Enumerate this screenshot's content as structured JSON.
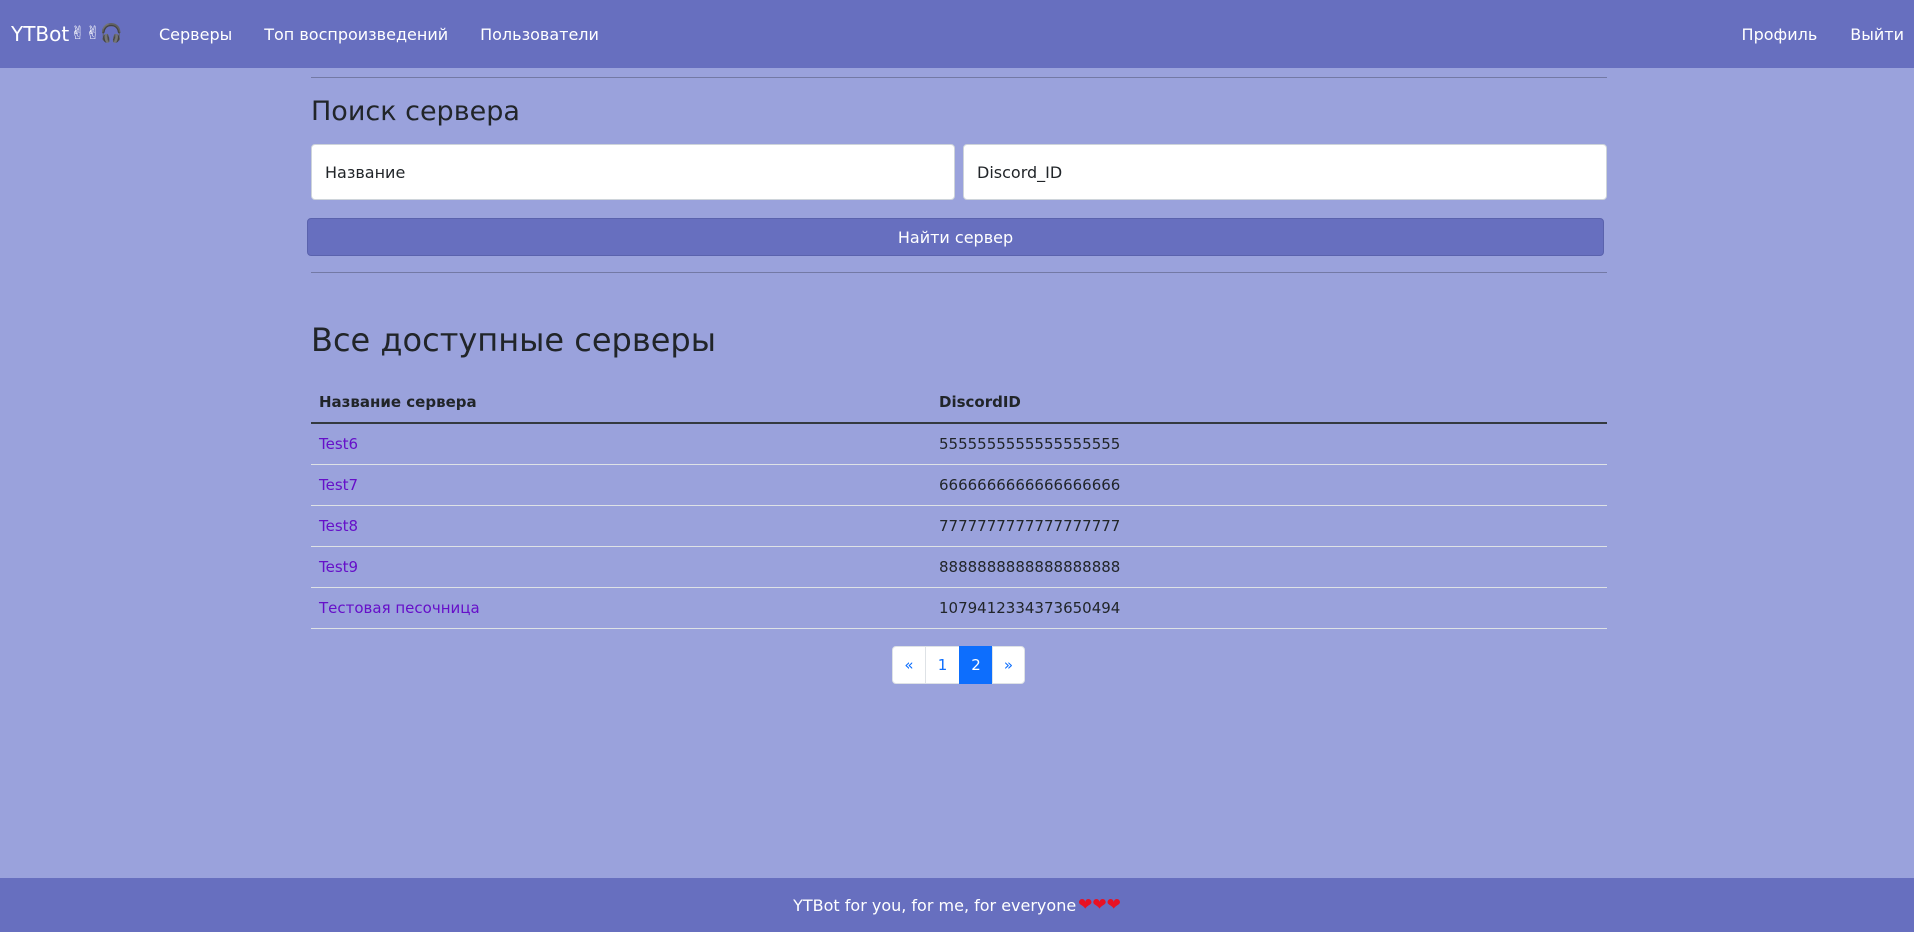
{
  "navbar": {
    "brand": "YTBot",
    "brand_emoji": "✌✌🎧",
    "links": [
      "Серверы",
      "Топ воспроизведений",
      "Пользователи"
    ],
    "profile": "Профиль",
    "logout": "Выйти"
  },
  "search": {
    "title": "Поиск сервера",
    "name_placeholder": "Название",
    "id_placeholder": "Discord_ID",
    "button": "Найти сервер"
  },
  "servers": {
    "title": "Все доступные серверы",
    "columns": [
      "Название сервера",
      "DiscordID"
    ],
    "rows": [
      {
        "name": "Test6",
        "discord_id": "5555555555555555555"
      },
      {
        "name": "Test7",
        "discord_id": "6666666666666666666"
      },
      {
        "name": "Test8",
        "discord_id": "7777777777777777777"
      },
      {
        "name": "Test9",
        "discord_id": "8888888888888888888"
      },
      {
        "name": "Тестовая песочница",
        "discord_id": "1079412334373650494"
      }
    ]
  },
  "pagination": {
    "prev": "«",
    "pages": [
      "1",
      "2"
    ],
    "current": "2",
    "next": "»"
  },
  "footer": {
    "text": "YTBot for you, for me, for everyone",
    "hearts": "❤❤❤"
  },
  "colors": {
    "navbar": "#676fbf",
    "background": "#9aa2dc",
    "link": "#6610c9",
    "active_page": "#0d6efd"
  }
}
